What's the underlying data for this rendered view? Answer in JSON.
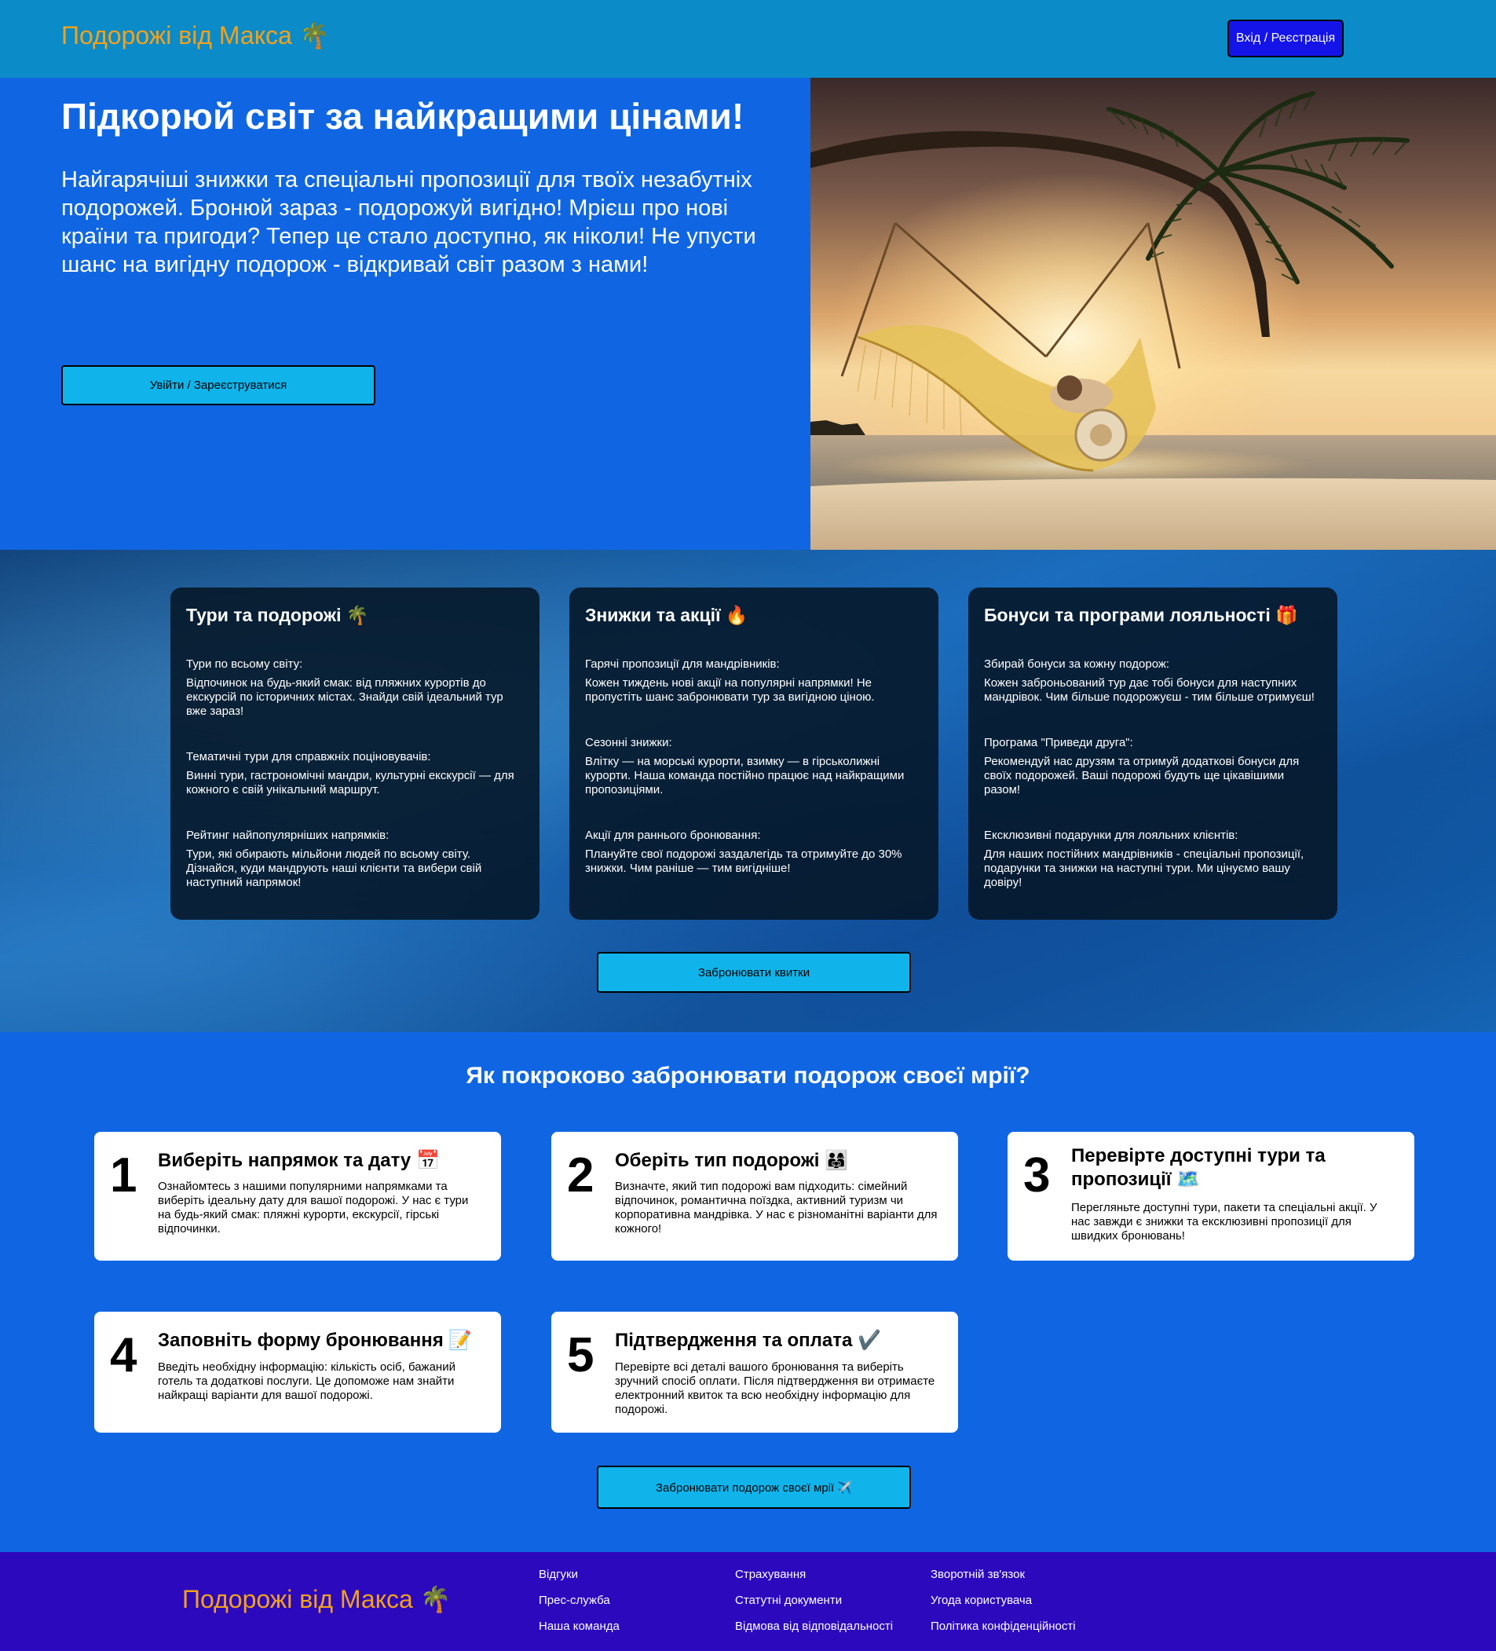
{
  "header": {
    "logo": "Подорожі від Макса 🌴",
    "login_button": "Вхід / Реєстрація"
  },
  "hero": {
    "title": "Підкорюй світ за найкращими цінами!",
    "text": "Найгарячіші знижки та спеціальні пропозиції для твоїх незабутніх подорожей. Бронюй зараз - подорожуй вигідно! Мрієш про нові країни та пригоди? Тепер це стало доступно, як ніколи! Не упусти шанс на вигідну подорож - відкривай світ разом з нами!",
    "button": "Увійти / Зареєструватися"
  },
  "features": {
    "cards": [
      {
        "title": "Тури та подорожі 🌴",
        "blocks": [
          {
            "head": "Тури по всьому світу:",
            "body": "Відпочинок на будь-який смак: від пляжних курортів до екскурсій по історичних містах. Знайди свій ідеальний тур вже зараз!"
          },
          {
            "head": "Тематичні тури для справжніх поціновувачів:",
            "body": "Винні тури, гастрономічні мандри, культурні екскурсії — для кожного є свій унікальний маршрут."
          },
          {
            "head": "Рейтинг найпопулярніших напрямків:",
            "body": "Тури, які обирають мільйони людей по всьому світу. Дізнайся, куди мандрують наші клієнти та вибери свій наступний напрямок!"
          }
        ]
      },
      {
        "title": "Знижки та акції 🔥",
        "blocks": [
          {
            "head": "Гарячі пропозиції для мандрівників:",
            "body": "Кожен тиждень нові акції на популярні напрямки! Не пропустіть шанс забронювати тур за вигідною ціною."
          },
          {
            "head": "Сезонні знижки:",
            "body": "Влітку — на морські курорти, взимку — в гірськолижні курорти. Наша команда постійно працює над найкращими пропозиціями."
          },
          {
            "head": "Акції для раннього бронювання:",
            "body": "Плануйте свої подорожі заздалегідь та отримуйте до 30% знижки. Чим раніше — тим вигідніше!"
          }
        ]
      },
      {
        "title": "Бонуси та програми лояльності 🎁",
        "blocks": [
          {
            "head": "Збирай бонуси за кожну подорож:",
            "body": "Кожен заброньований тур дає тобі бонуси для наступних мандрівок. Чим більше подорожуєш - тим більше отримуєш!"
          },
          {
            "head": "Програма \"Приведи друга\":",
            "body": "Рекомендуй нас друзям та отримуй додаткові бонуси для своїх подорожей. Ваші подорожі будуть ще цікавішими разом!"
          },
          {
            "head": "Ексклюзивні подарунки для лояльних клієнтів:",
            "body": "Для наших постійних мандрівників - спеціальні пропозиції, подарунки та знижки на наступні тури. Ми цінуємо вашу довіру!"
          }
        ]
      }
    ],
    "button": "Забронювати квитки"
  },
  "steps": {
    "title": "Як покроково забронювати подорож своєї мрії?",
    "items": [
      {
        "num": "1",
        "title": "Виберіть напрямок та дату 📅",
        "text": "Ознайомтесь з нашими популярними напрямками та виберіть ідеальну дату для вашої подорожі. У нас є тури на будь-який смак: пляжні курорти, екскурсії, гірські відпочинки."
      },
      {
        "num": "2",
        "title": "Оберіть тип подорожі 👨‍👩‍👧",
        "text": "Визначте, який тип подорожі вам підходить: сімейний відпочинок, романтична поїздка, активний туризм чи корпоративна мандрівка. У нас є різноманітні варіанти для кожного!"
      },
      {
        "num": "3",
        "title": "Перевірте доступні тури та пропозиції 🗺️",
        "text": "Перегляньте доступні тури, пакети та спеціальні акції. У нас завжди є знижки та ексклюзивні пропозиції для швидких бронювань!"
      },
      {
        "num": "4",
        "title": "Заповніть форму бронювання 📝",
        "text": "Введіть необхідну інформацію: кількість осіб, бажаний готель та додаткові послуги. Це допоможе нам знайти найкращі варіанти для вашої подорожі."
      },
      {
        "num": "5",
        "title": "Підтвердження та оплата ✔️",
        "text": "Перевірте всі деталі вашого бронювання та виберіть зручний спосіб оплати. Після підтвердження ви отримаєте електронний квиток та всю необхідну інформацію для подорожі."
      }
    ],
    "button": "Забронювати подорож своєї мрії ✈️"
  },
  "footer": {
    "logo": "Подорожі від Макса 🌴",
    "columns": [
      [
        "Відгуки",
        "Прес-служба",
        "Наша команда"
      ],
      [
        "Страхування",
        "Статутні документи",
        "Відмова від відповідальності"
      ],
      [
        "Зворотній зв'язок",
        "Угода користувача",
        "Політика конфіденційності"
      ]
    ]
  }
}
